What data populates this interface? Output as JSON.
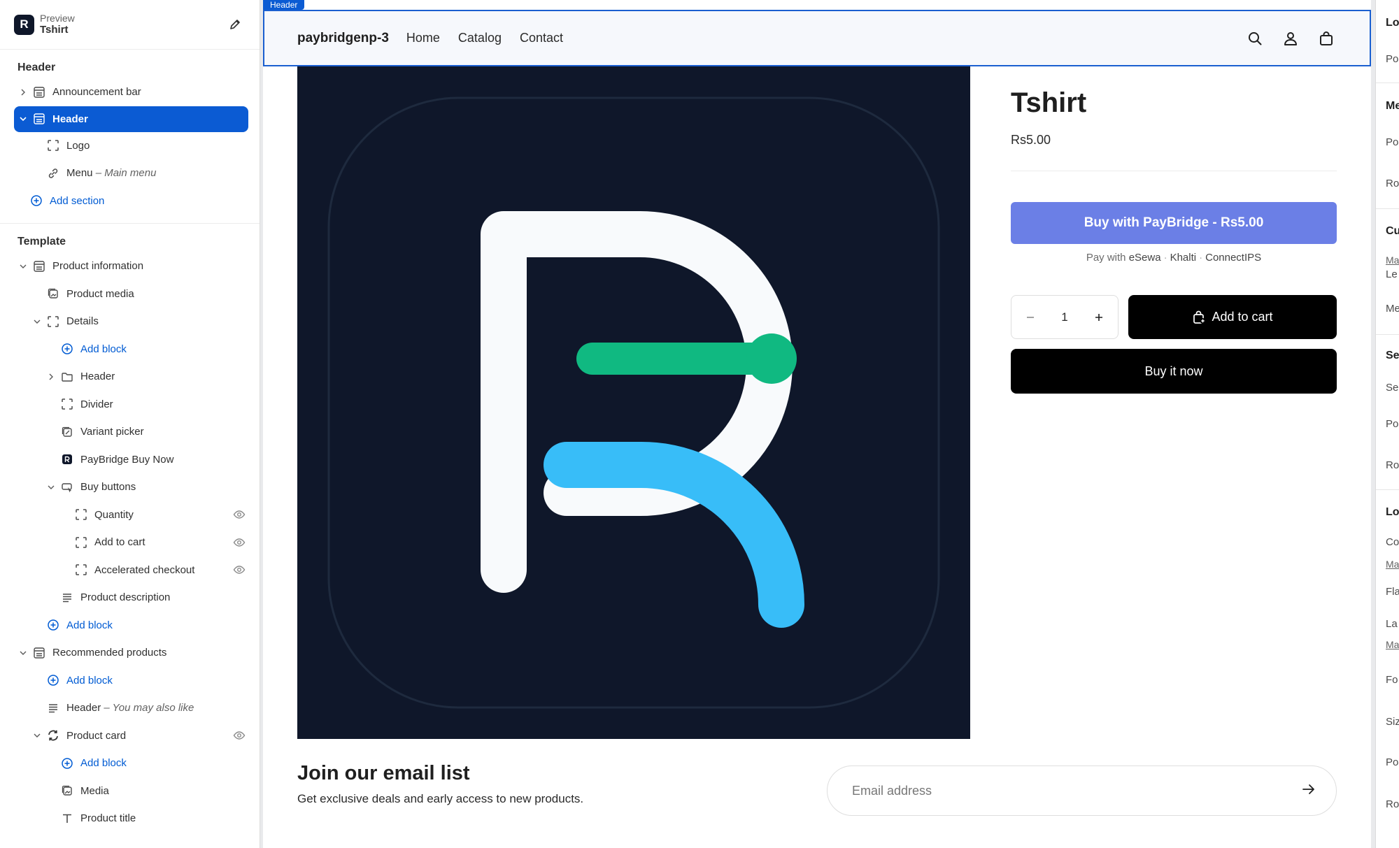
{
  "sidebar": {
    "preview_label": "Preview",
    "page_name": "Tshirt",
    "header_group": {
      "title": "Header",
      "items": {
        "announcement": "Announcement bar",
        "header": "Header",
        "logo": "Logo",
        "menu": "Menu",
        "menu_sub": "– Main menu",
        "add_section": "Add section"
      }
    },
    "template_group": {
      "title": "Template",
      "product_information": "Product information",
      "product_media": "Product media",
      "details": "Details",
      "add_block": "Add block",
      "header": "Header",
      "divider": "Divider",
      "variant_picker": "Variant picker",
      "paybridge_buy_now": "PayBridge Buy Now",
      "buy_buttons": "Buy buttons",
      "quantity": "Quantity",
      "add_to_cart": "Add to cart",
      "accelerated_checkout": "Accelerated checkout",
      "product_description": "Product description",
      "recommended_products": "Recommended products",
      "header_sub": "– You may also like",
      "product_card": "Product card",
      "media": "Media",
      "product_title": "Product title"
    }
  },
  "preview": {
    "header_tag": "Header",
    "brand": "paybridgenp-3",
    "nav": [
      "Home",
      "Catalog",
      "Contact"
    ],
    "product": {
      "title": "Tshirt",
      "price": "Rs5.00",
      "paybridge_button": "Buy with PayBridge - Rs5.00",
      "pay_with_label": "Pay with",
      "pay_methods": [
        "eSewa",
        "Khalti",
        "ConnectIPS"
      ],
      "quantity": "1",
      "add_to_cart": "Add to cart",
      "buy_now": "Buy it now"
    },
    "newsletter": {
      "title": "Join our email list",
      "subtitle": "Get exclusive deals and early access to new products.",
      "placeholder": "Email address"
    }
  },
  "right_panel": {
    "labels": [
      "Lo",
      "Po",
      "Me",
      "Po",
      "Ro",
      "Cu",
      "Ma",
      "Le",
      "Me",
      "Se",
      "Se",
      "Po",
      "Ro",
      "Lo",
      "Co",
      "Ma",
      "Fla",
      "La",
      "Ma",
      "Fo",
      "Siz",
      "Po",
      "Ro"
    ]
  },
  "colors": {
    "accent": "#0b5bd3",
    "paybridge": "#6b7fe6",
    "logo_bg": "#0f172a",
    "logo_green": "#10b981",
    "logo_blue": "#38bdf8"
  }
}
